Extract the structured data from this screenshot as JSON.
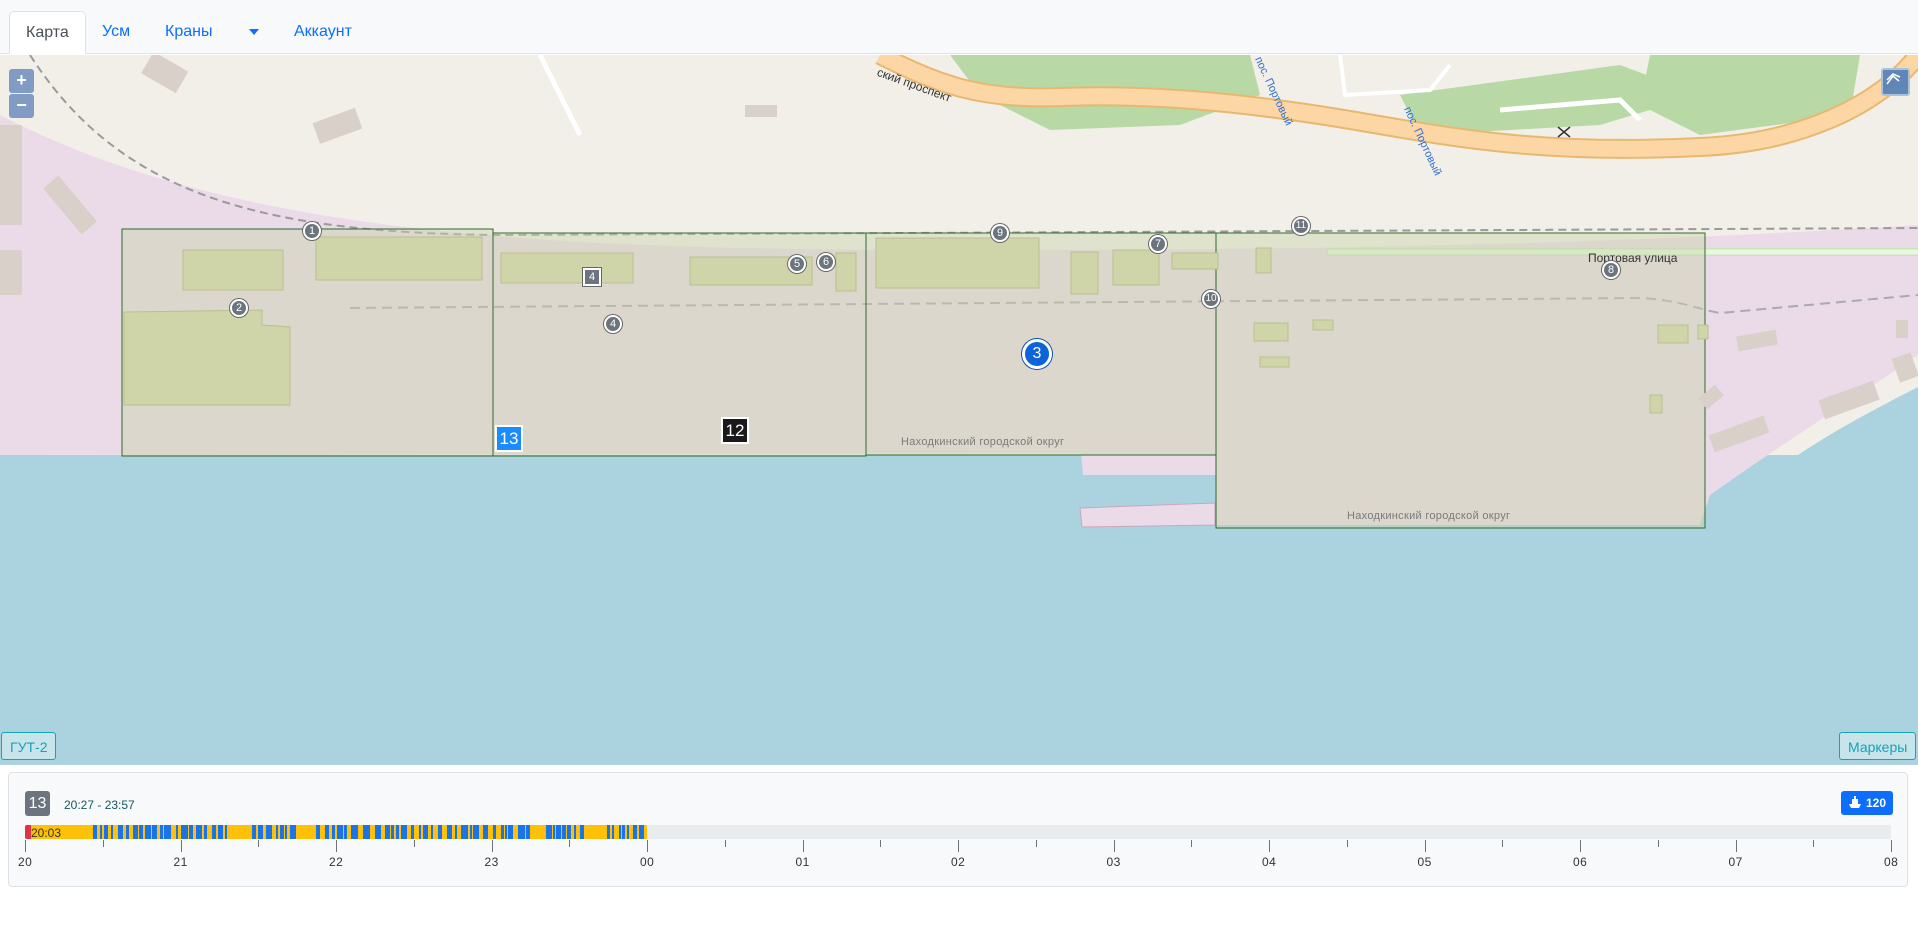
{
  "nav": {
    "tabs": [
      {
        "label": "Карта",
        "active": true
      },
      {
        "label": "Усм",
        "active": false
      },
      {
        "label": "Краны",
        "active": false
      },
      {
        "label": "",
        "dropdown": true
      },
      {
        "label": "Аккаунт",
        "active": false
      }
    ]
  },
  "map": {
    "zoom_in": "+",
    "zoom_out": "−",
    "left_button": "ГУТ-2",
    "right_button": "Маркеры",
    "labels": {
      "prospect": "ский проспект",
      "street": "Портовая улица",
      "okrug1": "Находкинский городской округ",
      "okrug2": "Находкинский городской округ",
      "bus1": "пос. Портовый",
      "bus2": "пос. Портовый"
    },
    "markers": [
      "1",
      "2",
      "4",
      "4",
      "5",
      "6",
      "9",
      "7",
      "10",
      "11",
      "8"
    ],
    "active_marker": "3",
    "cranes": [
      "13",
      "12"
    ]
  },
  "timeline": {
    "crane_number": "13",
    "time_range": "20:27 - 23:57",
    "count": "120",
    "now_label": "20:03",
    "hours": [
      "20",
      "21",
      "22",
      "23",
      "00",
      "01",
      "02",
      "03",
      "04",
      "05",
      "06",
      "07",
      "08"
    ],
    "colors": {
      "working": "#1a73e8",
      "idle": "#ffc107",
      "alarm": "#dc3545"
    }
  }
}
